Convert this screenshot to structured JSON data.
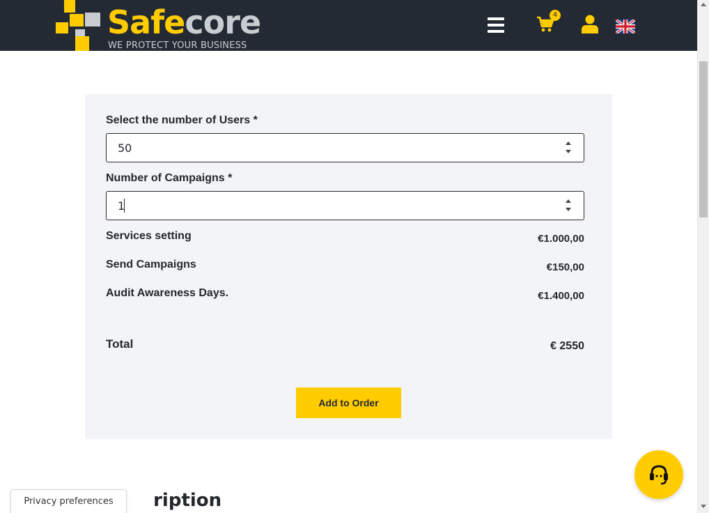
{
  "header": {
    "brand_part1": "Safe",
    "brand_part2": "core",
    "tagline": "WE PROTECT YOUR BUSINESS",
    "cart_count": "4",
    "colors": {
      "background": "#242a33",
      "accent": "#ffcc00",
      "muted": "#c9ccd1"
    },
    "icons": [
      "hamburger-menu-icon",
      "shopping-cart-icon",
      "user-icon",
      "uk-flag-icon"
    ]
  },
  "form": {
    "users_label": "Select the number of Users *",
    "users_value": "50",
    "campaigns_label": "Number of Campaigns *",
    "campaigns_value": "1"
  },
  "summary": {
    "lines": [
      {
        "label": "Services setting",
        "price": "€1.000,00"
      },
      {
        "label": "Send Campaigns",
        "price": "€150,00"
      },
      {
        "label": "Audit Awareness Days.",
        "price": "€1.400,00"
      }
    ],
    "total_label": "Total",
    "total_value": "€ 2550"
  },
  "actions": {
    "add_to_order": "Add to Order"
  },
  "page": {
    "section_heading_partial": "ription",
    "privacy_button": "Privacy preferences",
    "support_icon": "headset-support-icon"
  }
}
